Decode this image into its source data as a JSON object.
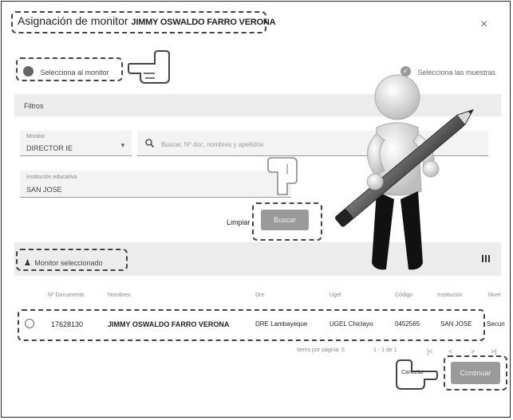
{
  "dialog": {
    "title": "Asignación de monitor",
    "title_name": "JIMMY OSWALDO FARRO VERONA",
    "close_glyph": "×"
  },
  "steps": {
    "step1_label": "Selecciona al monitor",
    "step2_label": "Selecciona las muestras"
  },
  "filters": {
    "header": "Filtros",
    "role_label": "Monitor",
    "role_value": "DIRECTOR IE",
    "search_placeholder": "Buscar, Nº doc, nombres y apellidos",
    "institution_label": "Institución educativa",
    "institution_value": "SAN JOSE",
    "clear_label": "Limpiar",
    "search_button": "Buscar"
  },
  "selected": {
    "header": "Monitor seleccionado"
  },
  "table": {
    "columns": [
      "Nº Documento",
      "Nombres",
      "Dre",
      "Ugel",
      "Código",
      "Institución",
      "Nivel"
    ],
    "rows": [
      {
        "doc": "17628130",
        "name": "JIMMY OSWALDO FARRO VERONA",
        "dre": "DRE Lambayeque",
        "ugel": "UGEL Chiclayo",
        "code": "0452565",
        "institution": "SAN JOSE",
        "level": "Secun"
      }
    ]
  },
  "pagination": {
    "items_label": "Items por página: 5",
    "range": "1 - 1 de 1",
    "first": "|<",
    "prev": "<",
    "next": ">",
    "last": ">|"
  },
  "footer": {
    "cancel_label": "Cancelar",
    "continue_label": "Continuar"
  },
  "colors": {
    "annotation": "#444444",
    "panel": "#ececec",
    "button": "#9a9a9a"
  }
}
